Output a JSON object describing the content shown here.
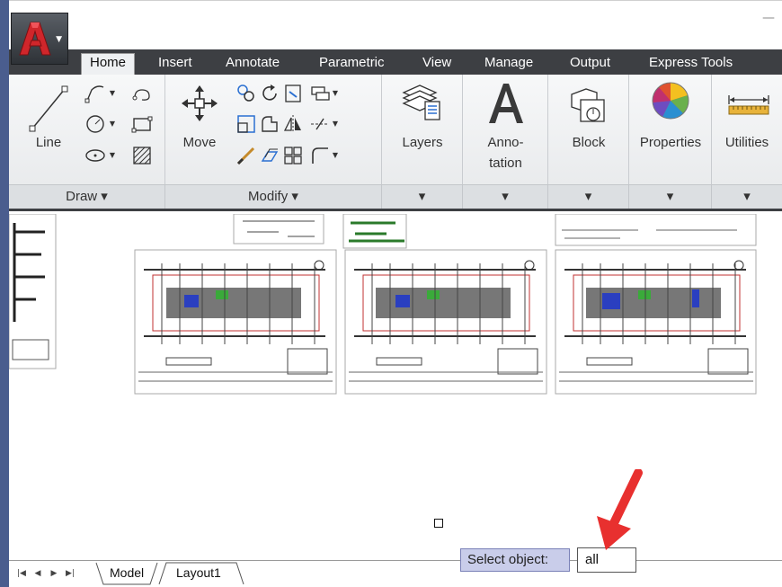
{
  "window": {
    "minimize_glyph": "—"
  },
  "app_button": {
    "icon": "autocad-logo-icon",
    "accent": "#d0262b"
  },
  "tabs": [
    {
      "label": "Home",
      "active": true
    },
    {
      "label": "Insert"
    },
    {
      "label": "Annotate"
    },
    {
      "label": "Parametric"
    },
    {
      "label": "View"
    },
    {
      "label": "Manage"
    },
    {
      "label": "Output"
    },
    {
      "label": "Express Tools"
    }
  ],
  "ribbon": {
    "draw": {
      "line_label": "Line",
      "title": "Draw ▾"
    },
    "modify": {
      "move_label": "Move",
      "title": "Modify ▾"
    },
    "layers_label": "Layers",
    "annotation_label_1": "Anno-",
    "annotation_label_2": "tation",
    "block_label": "Block",
    "properties_label": "Properties",
    "utilities_label": "Utilities",
    "panel_dropdown": "▾"
  },
  "bottom": {
    "nav": [
      "|◀",
      "◀",
      "▶",
      "▶|"
    ],
    "model_tab": "Model",
    "layout_tab": "Layout1",
    "prompt_label": "Select object:",
    "command_value": "all"
  },
  "colors": {
    "tabbar": "#3d3f43",
    "prompt_bg": "#c9cdea",
    "arrow": "#e8302f"
  }
}
